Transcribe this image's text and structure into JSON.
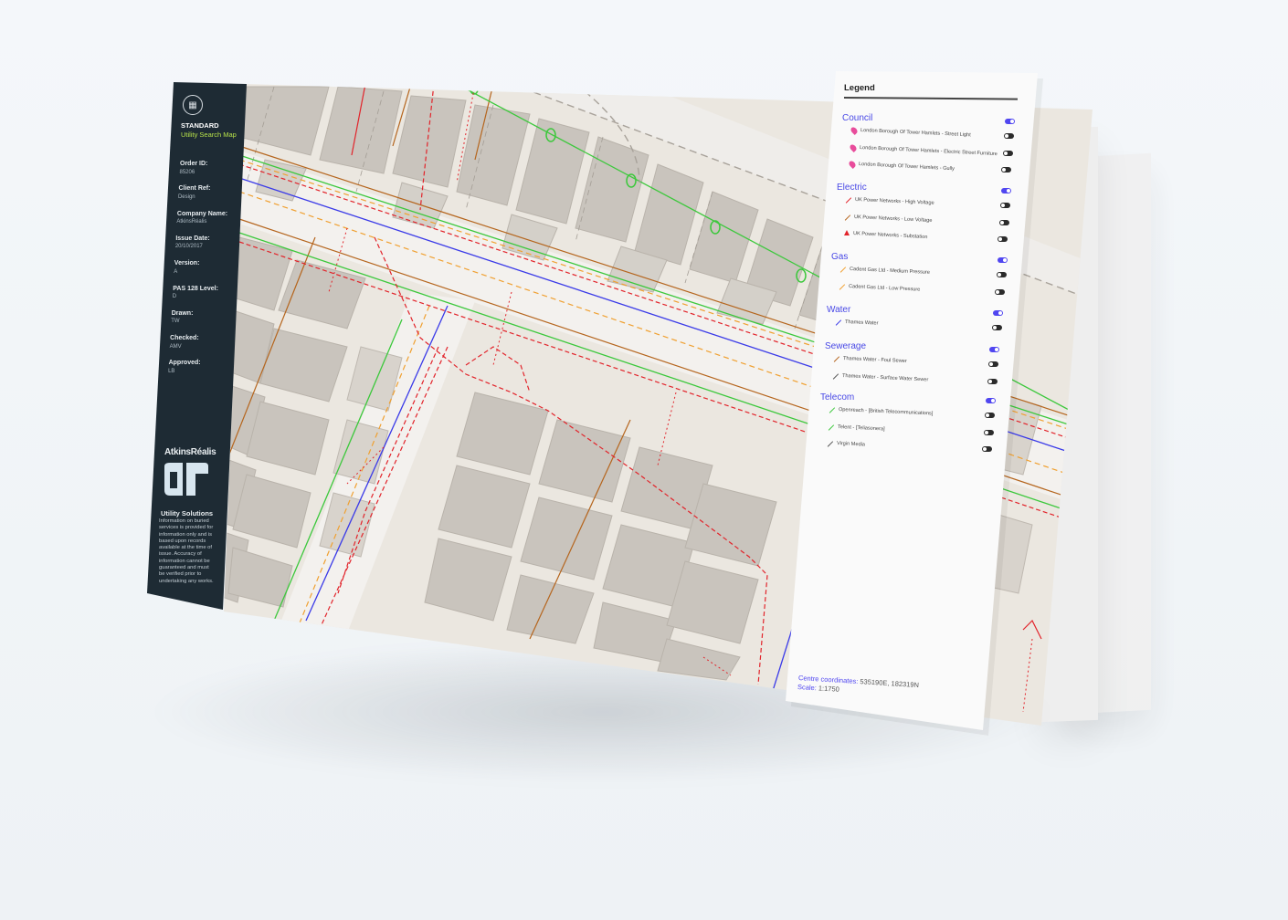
{
  "sidebar": {
    "title": "STANDARD",
    "subtitle": "Utility Search Map",
    "fields": [
      {
        "label": "Order ID:",
        "value": "85206"
      },
      {
        "label": "Client Ref:",
        "value": "Design"
      },
      {
        "label": "Company Name:",
        "value": "AtkinsRéalis"
      },
      {
        "label": "Issue Date:",
        "value": "20/10/2017"
      },
      {
        "label": "Version:",
        "value": "A"
      },
      {
        "label": "PAS 128 Level:",
        "value": "D"
      },
      {
        "label": "Drawn:",
        "value": "TW"
      },
      {
        "label": "Checked:",
        "value": "AMV"
      },
      {
        "label": "Approved:",
        "value": "LB"
      }
    ],
    "brand": "AtkinsRéalis",
    "section": "Utility Solutions",
    "note": "Information on buried services is provided for information only and is based upon records available at the time of issue. Accuracy of information cannot be guaranteed and must be verified prior to undertaking any works."
  },
  "legend": {
    "title": "Legend",
    "categories": [
      {
        "name": "Council",
        "toggle_on": true,
        "items": [
          {
            "label": "London Borough Of Tower Hamlets - Street Light",
            "toggle_on": false
          },
          {
            "label": "London Borough Of Tower Hamlets - Electric Street Furniture",
            "toggle_on": false
          },
          {
            "label": "London Borough Of Tower Hamlets - Gully",
            "toggle_on": false
          }
        ]
      },
      {
        "name": "Electric",
        "toggle_on": true,
        "items": [
          {
            "label": "UK Power Networks - High Voltage",
            "toggle_on": false
          },
          {
            "label": "UK Power Networks - Low Voltage",
            "toggle_on": false
          },
          {
            "label": "UK Power Networks - Substation",
            "toggle_on": false
          }
        ]
      },
      {
        "name": "Gas",
        "toggle_on": true,
        "items": [
          {
            "label": "Cadent Gas Ltd - Medium Pressure",
            "toggle_on": false
          },
          {
            "label": "Cadent Gas Ltd - Low Pressure",
            "toggle_on": false
          }
        ]
      },
      {
        "name": "Water",
        "toggle_on": true,
        "items": [
          {
            "label": "Thames Water",
            "toggle_on": false
          }
        ]
      },
      {
        "name": "Sewerage",
        "toggle_on": true,
        "items": [
          {
            "label": "Thames Water - Foul Sewer",
            "toggle_on": false
          },
          {
            "label": "Thames Water - Surface Water Sewer",
            "toggle_on": false
          }
        ]
      },
      {
        "name": "Telecom",
        "toggle_on": true,
        "items": [
          {
            "label": "Openreach - [British Telecommunications]",
            "toggle_on": false
          },
          {
            "label": "Telent - [Teliasonera]",
            "toggle_on": false
          },
          {
            "label": "Virgin Media",
            "toggle_on": false
          }
        ]
      }
    ],
    "coords_label": "Centre coordinates:",
    "coords_value": "535190E, 182319N",
    "scale_label": "Scale:",
    "scale_value": "1:1750"
  },
  "colors": {
    "sidebar_bg": "#1e2b34",
    "accent_green": "#b7e14a",
    "legend_category": "#4848e6",
    "toggle_on": "#5046f0",
    "map_bg": "#ebe7e0",
    "building": "#c9c4bd",
    "electric_hv": "#e2232a",
    "electric_lv": "#b5651d",
    "gas": "#f0a030",
    "water": "#3a3ae8",
    "telecom_openreach": "#3cc83c",
    "council_pin": "#e84c9b"
  },
  "icons": [
    "brand-badge-icon",
    "atkinsrealis-logo-icon",
    "street-light-pin-icon",
    "street-furniture-pin-icon",
    "gully-pin-icon",
    "substation-triangle-icon"
  ]
}
